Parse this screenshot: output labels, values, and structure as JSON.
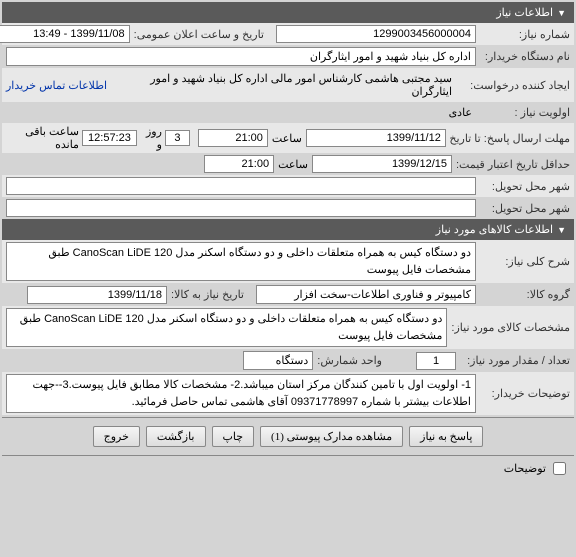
{
  "sections": {
    "need_info": "اطلاعات نیاز",
    "goods_info": "اطلاعات کالاهای مورد نیاز"
  },
  "need": {
    "number_label": "شماره نیاز:",
    "number": "1299003456000004",
    "announce_label": "تاریخ و ساعت اعلان عمومی:",
    "announce": "1399/11/08 - 13:49",
    "buyer_org_label": "نام دستگاه خریدار:",
    "buyer_org": "اداره کل بنیاد شهید و امور ایثارگران",
    "creator_label": "ایجاد کننده درخواست:",
    "creator": "سید مجتبی هاشمی کارشناس امور مالی اداره کل بنیاد شهید و امور ایثارگران",
    "contact_link": "اطلاعات تماس خریدار",
    "priority_label": "اولویت نیاز :",
    "priority": "عادی",
    "deadline_label": "مهلت ارسال پاسخ:",
    "until_label": "تا تاریخ :",
    "deadline_date": "1399/11/12",
    "time_label": "ساعت",
    "deadline_time": "21:00",
    "remaining_days": "3",
    "remaining_time": "12:57:23",
    "remaining_text1": "روز و",
    "remaining_text2": "ساعت باقی مانده",
    "validity_label": "حداقل تاریخ اعتبار قیمت:",
    "validity_date": "1399/12/15",
    "validity_time": "21:00",
    "delivery_city_label": "شهر محل تحویل:",
    "delivery_city": "",
    "buyer_city_label": "شهر محل تحویل:",
    "buyer_city": ""
  },
  "goods": {
    "general_desc_label": "شرح کلی نیاز:",
    "general_desc": "دو دستگاه کیس به همراه متعلقات داخلی و دو دستگاه اسکنر مدل CanoScan LiDE 120 طبق مشخصات فایل پیوست",
    "group_label": "گروه کالا:",
    "group": "کامپیوتر و فناوری اطلاعات-سخت افزار",
    "need_date_label": "تاریخ نیاز به کالا:",
    "need_date": "1399/11/18",
    "spec_label": "مشخصات کالای مورد نیاز:",
    "spec": "دو دستگاه کیس به همراه متعلقات داخلی و دو دستگاه اسکنر مدل CanoScan LiDE 120 طبق مشخصات فایل پیوست",
    "qty_label": "تعداد / مقدار مورد نیاز:",
    "qty": "1",
    "unit_label": "واحد شمارش:",
    "unit": "دستگاه",
    "buyer_notes_label": "توضیحات خریدار:",
    "buyer_notes": "1- اولویت اول با تامین کنندگان مرکز استان میباشد.2- مشخصات کالا مطابق فایل پیوست.3--جهت اطلاعات بیشتر با شماره 09371778997 آقای هاشمی تماس حاصل فرمائید."
  },
  "buttons": {
    "reply": "پاسخ به نیاز",
    "attachments": "مشاهده مدارک پیوستی",
    "attachments_count": "(1)",
    "print": "چاپ",
    "back": "بازگشت",
    "exit": "خروج"
  },
  "footer": {
    "notes_chk": "توضیحات"
  }
}
